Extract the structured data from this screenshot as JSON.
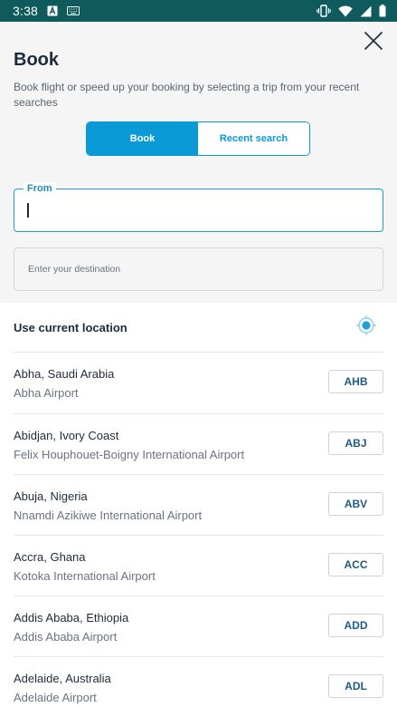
{
  "status_bar": {
    "time": "3:38",
    "left_icons": [
      "notification-a-icon",
      "keyboard-icon"
    ],
    "right_icons": [
      "vibrate-icon",
      "wifi-icon",
      "signal-icon",
      "battery-icon"
    ]
  },
  "header": {
    "title": "Book",
    "subtitle": "Book flight or speed up your booking by selecting a trip from your recent searches",
    "close_icon": "close-icon"
  },
  "segmented_control": {
    "options": [
      {
        "label": "Book",
        "active": true
      },
      {
        "label": "Recent search",
        "active": false
      }
    ]
  },
  "from_field": {
    "label": "From",
    "value": ""
  },
  "destination_field": {
    "placeholder": "Enter your destination",
    "value": ""
  },
  "current_location": {
    "label": "Use current location",
    "icon": "location-target-icon"
  },
  "airports": [
    {
      "city": "Abha, Saudi Arabia",
      "airport": "Abha Airport",
      "code": "AHB"
    },
    {
      "city": "Abidjan, Ivory Coast",
      "airport": "Felix Houphouet-Boigny International Airport",
      "code": "ABJ"
    },
    {
      "city": "Abuja, Nigeria",
      "airport": "Nnamdi Azikiwe International Airport",
      "code": "ABV"
    },
    {
      "city": "Accra, Ghana",
      "airport": "Kotoka International Airport",
      "code": "ACC"
    },
    {
      "city": "Addis Ababa, Ethiopia",
      "airport": "Addis Ababa Airport",
      "code": "ADD"
    },
    {
      "city": "Adelaide, Australia",
      "airport": "Adelaide Airport",
      "code": "ADL"
    }
  ],
  "colors": {
    "status_bar": "#0e5a5c",
    "accent": "#0a9ad6",
    "title": "#1f2b3b",
    "code_text": "#1c5c86"
  }
}
